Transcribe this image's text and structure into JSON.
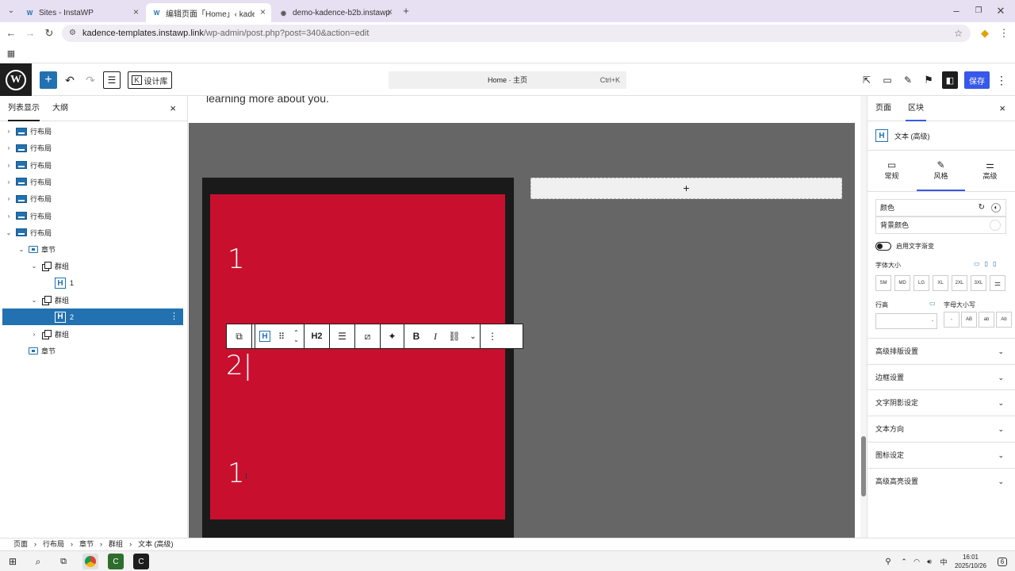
{
  "browser": {
    "tabs": [
      {
        "title": "Sites - InstaWP",
        "fav": "W"
      },
      {
        "title": "编辑页面「Home」‹ kadence",
        "fav": "W"
      },
      {
        "title": "demo-kadence-b2b.instawp.",
        "fav": "◉"
      }
    ],
    "new_tab": "+",
    "url_host": "kadence-templates.instawp.link",
    "url_path": "/wp-admin/post.php?post=340&action=edit"
  },
  "wp": {
    "logo": "W",
    "library_label": "设计库",
    "command_title": "Home · 主页",
    "command_shortcut": "Ctrl+K",
    "save_label": "保存"
  },
  "left_panel": {
    "tabs": [
      "列表显示",
      "大纲"
    ],
    "tree": [
      {
        "label": "行布局",
        "type": "row",
        "level": 0,
        "expand": "›"
      },
      {
        "label": "行布局",
        "type": "row",
        "level": 0,
        "expand": "›"
      },
      {
        "label": "行布局",
        "type": "row",
        "level": 0,
        "expand": "›"
      },
      {
        "label": "行布局",
        "type": "row",
        "level": 0,
        "expand": "›"
      },
      {
        "label": "行布局",
        "type": "row",
        "level": 0,
        "expand": "›"
      },
      {
        "label": "行布局",
        "type": "row",
        "level": 0,
        "expand": "›"
      },
      {
        "label": "行布局",
        "type": "row",
        "level": 0,
        "expand": "⌄"
      },
      {
        "label": "章节",
        "type": "section",
        "level": 1,
        "expand": "⌄"
      },
      {
        "label": "群组",
        "type": "group",
        "level": 2,
        "expand": "⌄"
      },
      {
        "label": "1",
        "type": "heading",
        "level": 3,
        "expand": ""
      },
      {
        "label": "群组",
        "type": "group",
        "level": 2,
        "expand": "⌄"
      },
      {
        "label": "2",
        "type": "heading",
        "level": 3,
        "expand": "",
        "selected": true
      },
      {
        "label": "群组",
        "type": "group",
        "level": 2,
        "expand": "›"
      },
      {
        "label": "章节",
        "type": "section",
        "level": 1,
        "expand": ""
      }
    ]
  },
  "canvas": {
    "top_text": "learning more about you.",
    "numbers": [
      "1",
      "2",
      "1"
    ],
    "add_symbol": "+",
    "toolbar_heading_level": "H2"
  },
  "right_panel": {
    "tabs": [
      "页面",
      "区块"
    ],
    "block_name": "文本 (高级)",
    "subtabs": [
      "常规",
      "风格",
      "高级"
    ],
    "color_label": "颜色",
    "bg_color_label": "背景颜色",
    "gradient_label": "启用文字渐变",
    "font_size_label": "字体大小",
    "sizes": [
      "SM",
      "MD",
      "LG",
      "XL",
      "2XL",
      "3XL"
    ],
    "line_height_label": "行高",
    "letter_case_label": "字母大小写",
    "case_options": [
      "-",
      "AB",
      "ab",
      "Ab"
    ],
    "accordions": [
      "高级排版设置",
      "边框设置",
      "文字阴影设定",
      "文本方向",
      "图标设定",
      "高级高亮设置"
    ]
  },
  "breadcrumbs": [
    "页面",
    "行布局",
    "章节",
    "群组",
    "文本 (高级)"
  ],
  "taskbar": {
    "time": "16:01",
    "date": "2025/10/26",
    "notification_count": "6"
  },
  "colors": {
    "red_box": "#c8102e",
    "accent": "#3858e9",
    "selection": "#2271b1"
  }
}
